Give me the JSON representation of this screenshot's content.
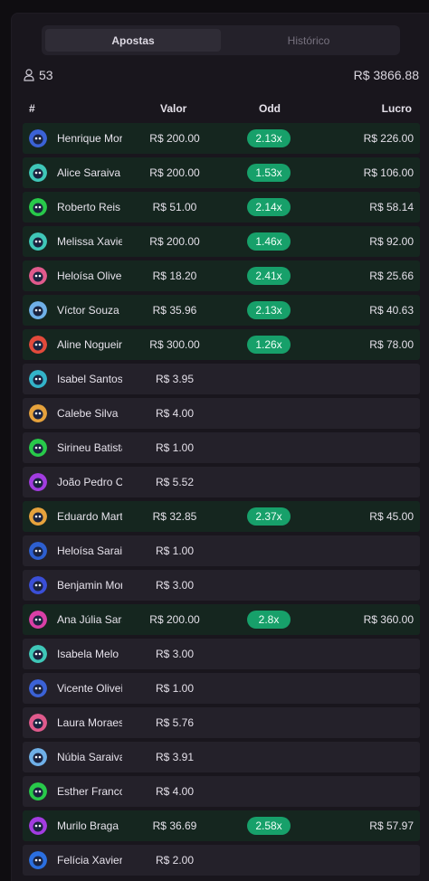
{
  "tabs": [
    {
      "label": "Apostas",
      "active": true
    },
    {
      "label": "Histórico",
      "active": false
    }
  ],
  "stats": {
    "players": "53",
    "total": "R$ 3866.88"
  },
  "headers": {
    "rank": "#",
    "value": "Valor",
    "odd": "Odd",
    "profit": "Lucro"
  },
  "colors": {
    "win_row": "#15261f",
    "row": "#24212a",
    "odd_badge": "#17a06a"
  },
  "bets": [
    {
      "name": "Henrique Morais",
      "value": "R$ 200.00",
      "odd": "2.13x",
      "profit": "R$ 226.00",
      "avatar": "blue-cowboy-avatar",
      "color": "#3b62d6"
    },
    {
      "name": "Alice Saraiva",
      "value": "R$ 200.00",
      "odd": "1.53x",
      "profit": "R$ 106.00",
      "avatar": "teal-hood-avatar",
      "color": "#3fc7b8"
    },
    {
      "name": "Roberto Reis",
      "value": "R$ 51.00",
      "odd": "2.14x",
      "profit": "R$ 58.14",
      "avatar": "green-ring-avatar",
      "color": "#28c94a"
    },
    {
      "name": "Melissa Xavier",
      "value": "R$ 200.00",
      "odd": "1.46x",
      "profit": "R$ 92.00",
      "avatar": "teal-hood-avatar",
      "color": "#3fc7b8"
    },
    {
      "name": "Heloísa Oliveira",
      "value": "R$ 18.20",
      "odd": "2.41x",
      "profit": "R$ 25.66",
      "avatar": "pink-blob-avatar",
      "color": "#e05a8c"
    },
    {
      "name": "Víctor Souza",
      "value": "R$ 35.96",
      "odd": "2.13x",
      "profit": "R$ 40.63",
      "avatar": "sky-blob-avatar",
      "color": "#6fb0e8"
    },
    {
      "name": "Aline Nogueira",
      "value": "R$ 300.00",
      "odd": "1.26x",
      "profit": "R$ 78.00",
      "avatar": "red-ring-avatar",
      "color": "#e24a3b"
    },
    {
      "name": "Isabel Santos",
      "value": "R$ 3.95",
      "odd": "",
      "profit": "",
      "avatar": "cyan-blob-avatar",
      "color": "#33b3c9"
    },
    {
      "name": "Calebe Silva",
      "value": "R$ 4.00",
      "odd": "",
      "profit": "",
      "avatar": "orange-blob-avatar",
      "color": "#e6a23c"
    },
    {
      "name": "Sirineu Batista",
      "value": "R$ 1.00",
      "odd": "",
      "profit": "",
      "avatar": "green-ring-avatar",
      "color": "#28c94a"
    },
    {
      "name": "João Pedro Costa",
      "value": "R$ 5.52",
      "odd": "",
      "profit": "",
      "avatar": "purple-blob-avatar",
      "color": "#a23ce0"
    },
    {
      "name": "Eduardo Martins",
      "value": "R$ 32.85",
      "odd": "2.37x",
      "profit": "R$ 45.00",
      "avatar": "orange-blob-avatar",
      "color": "#e6a23c"
    },
    {
      "name": "Heloísa Saraiva",
      "value": "R$ 1.00",
      "odd": "",
      "profit": "",
      "avatar": "blue-globe-avatar",
      "color": "#2d5fd0"
    },
    {
      "name": "Benjamin Moraes",
      "value": "R$ 3.00",
      "odd": "",
      "profit": "",
      "avatar": "navy-blob-avatar",
      "color": "#3a4fd8"
    },
    {
      "name": "Ana Júlia Saraiva",
      "value": "R$ 200.00",
      "odd": "2.8x",
      "profit": "R$ 360.00",
      "avatar": "magenta-ring-avatar",
      "color": "#d93fa6"
    },
    {
      "name": "Isabela Melo",
      "value": "R$ 3.00",
      "odd": "",
      "profit": "",
      "avatar": "teal-hood-avatar",
      "color": "#3fc7b8"
    },
    {
      "name": "Vicente Oliveira",
      "value": "R$ 1.00",
      "odd": "",
      "profit": "",
      "avatar": "blue-cowboy-avatar",
      "color": "#3b62d6"
    },
    {
      "name": "Laura Moraes",
      "value": "R$ 5.76",
      "odd": "",
      "profit": "",
      "avatar": "pink-blob-avatar",
      "color": "#e05a8c"
    },
    {
      "name": "Núbia Saraiva",
      "value": "R$ 3.91",
      "odd": "",
      "profit": "",
      "avatar": "sky-blob-avatar",
      "color": "#6fb0e8"
    },
    {
      "name": "Esther Franco",
      "value": "R$ 4.00",
      "odd": "",
      "profit": "",
      "avatar": "green-ring-avatar",
      "color": "#28c94a"
    },
    {
      "name": "Murilo Braga",
      "value": "R$ 36.69",
      "odd": "2.58x",
      "profit": "R$ 57.97",
      "avatar": "purple-blob-avatar",
      "color": "#a23ce0"
    },
    {
      "name": "Felícia Xavier",
      "value": "R$ 2.00",
      "odd": "",
      "profit": "",
      "avatar": "blue-shades-avatar",
      "color": "#2b6fe0"
    }
  ]
}
